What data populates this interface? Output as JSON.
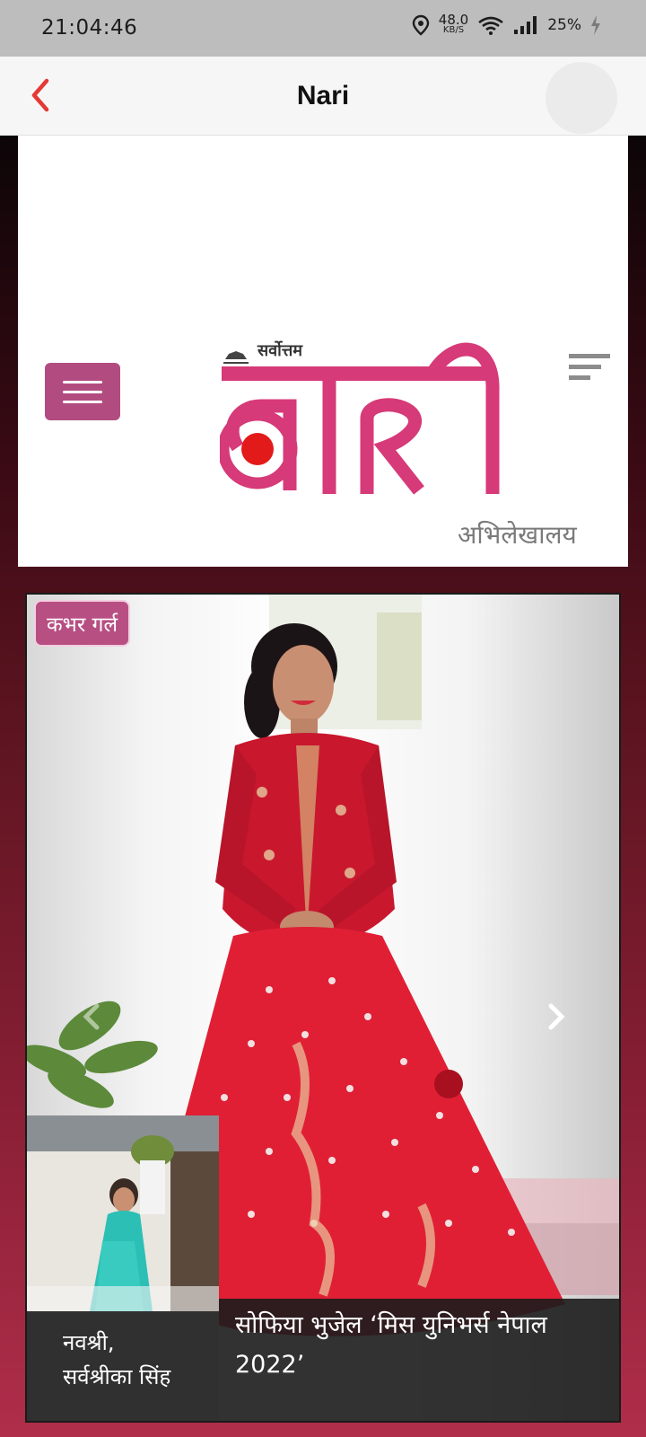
{
  "status_bar": {
    "time": "21:04:46",
    "net_speed_value": "48.0",
    "net_speed_unit": "KB/S",
    "battery": "25%",
    "icons": [
      "location-icon",
      "wifi-icon",
      "signal-icon",
      "battery-charging-icon"
    ]
  },
  "app_bar": {
    "title": "Nari",
    "back_icon": "chevron-left-icon",
    "accent_color": "#e53935"
  },
  "site_header": {
    "logo_small": "सर्वोत्तम",
    "logo_main": "नारी",
    "archive_label": "अभिलेखालय",
    "menu_icon": "hamburger-icon",
    "filter_icon": "sort-icon",
    "brand_color": "#d63a78",
    "menu_color": "#b24c80"
  },
  "slider": {
    "category_badge": "कभर गर्ल",
    "main_caption": "सोफिया भुजेल ‘मिस युनिभर्स नेपाल 2022’",
    "thumb_caption_line1": "नवश्री,",
    "thumb_caption_line2": "सर्वश्रीका सिंह",
    "prev_icon": "chevron-left-icon",
    "next_icon": "chevron-right-icon"
  }
}
